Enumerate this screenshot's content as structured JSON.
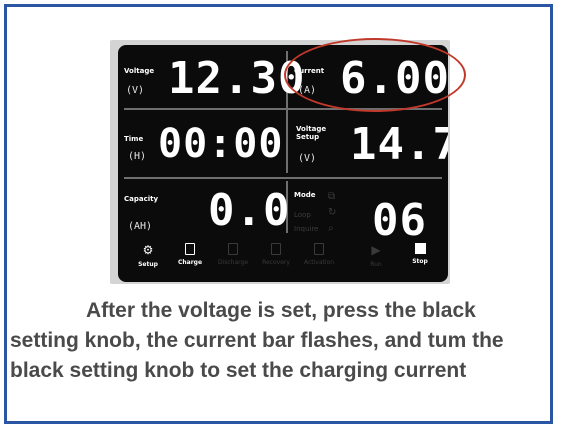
{
  "display": {
    "voltage": {
      "label": "Voltage",
      "unit": "(V)",
      "value": "12.30"
    },
    "current": {
      "label": "Current",
      "unit": "(A)",
      "value": "6.00"
    },
    "time": {
      "label": "Time",
      "unit": "(H)",
      "value": "00:00"
    },
    "voltage_setup": {
      "label": "Voltage Setup",
      "unit": "(V)",
      "value": "14.7"
    },
    "capacity": {
      "label": "Capacity",
      "unit": "(AH)",
      "value": "0.0"
    },
    "mode": {
      "label": "Mode",
      "options": [
        "Loop",
        "Inquire"
      ],
      "value": "06"
    }
  },
  "function_bar": {
    "setup": "Setup",
    "charge": "Charge",
    "discharge": "Discharge",
    "recovery": "Recovery",
    "activation": "Activation",
    "run": "Run",
    "stop": "Stop"
  },
  "highlight_color": "#c0392b",
  "border_color": "#2a56a4",
  "caption": "After the voltage is set, press the black setting knob, the current bar flashes, and tum the black setting knob to set the charging current"
}
